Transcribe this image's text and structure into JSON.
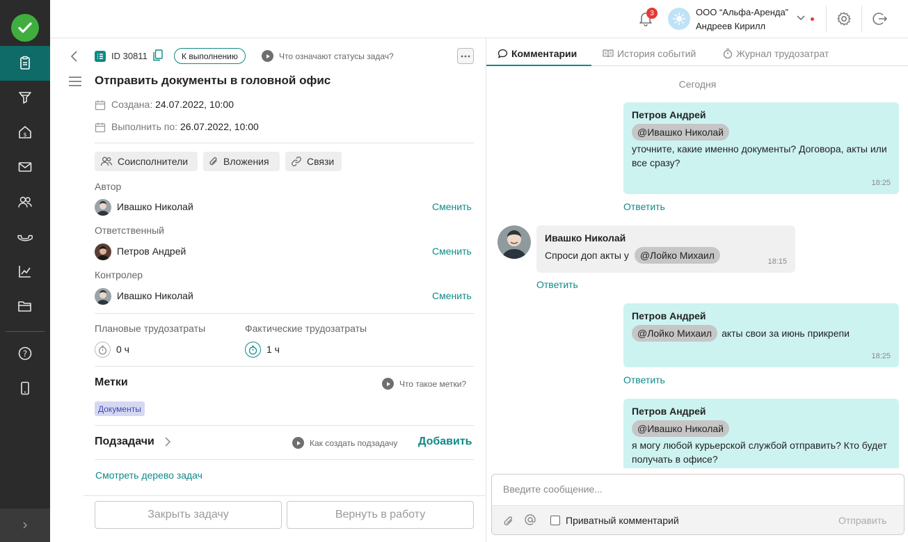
{
  "sidebar": {
    "items": [
      {
        "name": "tasks",
        "icon": "clipboard-icon",
        "active": true
      },
      {
        "name": "sales",
        "icon": "funnel-icon",
        "active": false
      },
      {
        "name": "finance",
        "icon": "money-house-icon",
        "active": false
      },
      {
        "name": "mail",
        "icon": "mail-icon",
        "active": false
      },
      {
        "name": "contacts",
        "icon": "people-icon",
        "active": false
      },
      {
        "name": "calls",
        "icon": "phone-icon",
        "active": false
      },
      {
        "name": "analytics",
        "icon": "chart-line-icon",
        "active": false
      },
      {
        "name": "documents",
        "icon": "folder-icon",
        "active": false
      }
    ],
    "bottom": [
      {
        "name": "help",
        "icon": "help-icon"
      },
      {
        "name": "mobile",
        "icon": "mobile-icon"
      }
    ],
    "accent": "#0e6b68"
  },
  "topbar": {
    "notifications_count": "3",
    "org_name": "ООО “Альфа-Аренда”",
    "user_name": "Андреев Кирилл"
  },
  "task": {
    "id": "ID 30811",
    "status": "К выполнению",
    "status_help": "Что означают статусы задач?",
    "title": "Отправить документы в головной офис",
    "created_label": "Создана:",
    "created_value": "24.07.2022, 10:00",
    "due_label": "Выполнить по:",
    "due_value": "26.07.2022, 10:00",
    "chips": [
      "Соисполнители",
      "Вложения",
      "Связи"
    ],
    "author_label": "Автор",
    "author": "Ивашко Николай",
    "responsible_label": "Ответственный",
    "responsible": "Петров Андрей",
    "controller_label": "Контролер",
    "controller": "Ивашко Николай",
    "change_label": "Сменить",
    "planned_label": "Плановые трудозатраты",
    "planned_value": "0 ч",
    "actual_label": "Фактические трудозатраты",
    "actual_value": "1 ч",
    "tags_title": "Метки",
    "tags_help": "Что такое метки?",
    "tags": [
      "Документы"
    ],
    "subtasks_title": "Подзадачи",
    "subtasks_help": "Как создать подзадачу",
    "subtasks_add": "Добавить",
    "tree_link": "Смотреть дерево задач",
    "close_button": "Закрыть задачу",
    "return_button": "Вернуть в работу"
  },
  "comments_panel": {
    "tabs": [
      "Комментарии",
      "История событий",
      "Журнал трудозатрат"
    ],
    "date_divider": "Сегодня",
    "reply_label": "Ответить",
    "messages": [
      {
        "author": "Петров Андрей",
        "mention": "@Ивашко Николай",
        "text": "уточните, какие именно документы? Договора, акты или все сразу?",
        "time": "18:25",
        "own": true
      },
      {
        "author": "Ивашко Николай",
        "text": "Спроси доп акты у",
        "mention": "@Лойко Михаил",
        "time": "18:15",
        "own": false
      },
      {
        "author": "Петров Андрей",
        "mention": "@Лойко Михаил",
        "text": "акты свои за июнь прикрепи",
        "time": "18:25",
        "own": true
      },
      {
        "author": "Петров Андрей",
        "mention": "@Ивашко Николай",
        "text": "я могу любой курьерской службой отправить? Кто будет получать в офисе?",
        "own": true
      }
    ],
    "composer_placeholder": "Введите сообщение...",
    "private_label": "Приватный комментарий",
    "send_label": "Отправить"
  }
}
